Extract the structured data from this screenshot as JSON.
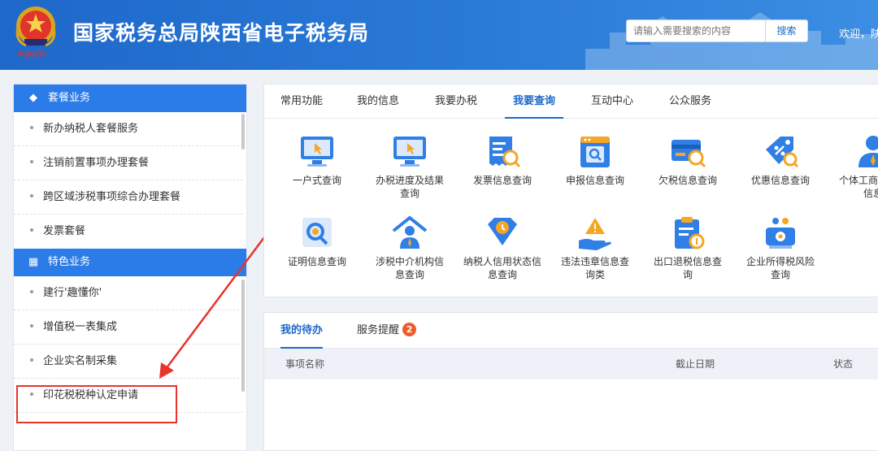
{
  "header": {
    "title": "国家税务总局陕西省电子税务局",
    "emblem_text": "中国税务",
    "search_placeholder": "请输入需要搜索的内容",
    "search_button": "搜索",
    "welcome": "欢迎，陕"
  },
  "sidebar": {
    "sections": [
      {
        "title": "套餐业务",
        "icon": "layers-icon",
        "items": [
          "新办纳税人套餐服务",
          "注销前置事项办理套餐",
          "跨区域涉税事项综合办理套餐",
          "发票套餐"
        ]
      },
      {
        "title": "特色业务",
        "icon": "grid-icon",
        "items": [
          "建行'趣懂你'",
          "增值税一表集成",
          "企业实名制采集",
          "印花税税种认定申请"
        ]
      }
    ]
  },
  "main": {
    "tabs": [
      "常用功能",
      "我的信息",
      "我要办税",
      "我要查询",
      "互动中心",
      "公众服务"
    ],
    "active_tab": "我要查询",
    "functions": [
      {
        "label": "一户式查询",
        "icon": "monitor-icon"
      },
      {
        "label": "办税进度及结果查询",
        "icon": "monitor-icon"
      },
      {
        "label": "发票信息查询",
        "icon": "invoice-search-icon"
      },
      {
        "label": "申报信息查询",
        "icon": "report-search-icon"
      },
      {
        "label": "欠税信息查询",
        "icon": "card-search-icon"
      },
      {
        "label": "优惠信息查询",
        "icon": "discount-icon"
      },
      {
        "label": "个体工商户定额信息",
        "icon": "person-icon"
      },
      {
        "label": "证明信息查询",
        "icon": "certificate-search-icon"
      },
      {
        "label": "涉税中介机构信息查询",
        "icon": "agency-icon"
      },
      {
        "label": "纳税人信用状态信息查询",
        "icon": "credit-icon"
      },
      {
        "label": "违法违章信息查询类",
        "icon": "warning-hand-icon"
      },
      {
        "label": "出口退税信息查询",
        "icon": "clipboard-icon"
      },
      {
        "label": "企业所得税风险查询",
        "icon": "risk-icon"
      }
    ]
  },
  "todo": {
    "tabs": [
      "我的待办",
      "服务提醒"
    ],
    "reminder_count": "2",
    "columns": [
      "事项名称",
      "截止日期",
      "状态"
    ]
  },
  "colors": {
    "brand": "#1e68c9",
    "sidebar_header": "#2b7ce8",
    "alert": "#e8342b",
    "badge": "#f05a28"
  }
}
